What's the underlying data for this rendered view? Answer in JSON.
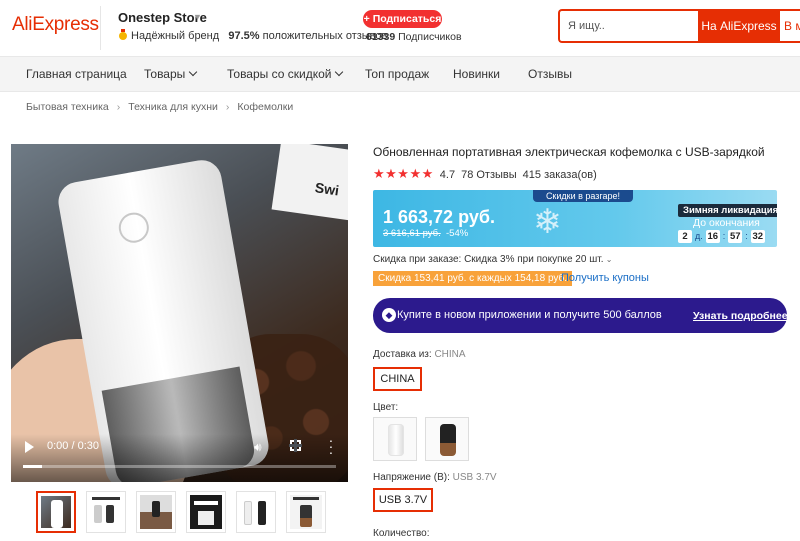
{
  "header": {
    "logo": "AliExpress",
    "store_name": "Onestep Store",
    "trusted_brand": "Надёжный бренд",
    "positive_percent": "97.5%",
    "positive_label": "положительных отзывов",
    "subscribe_label": "+ Подписаться",
    "subscriber_count": "61339",
    "subscriber_label": "Подписчиков",
    "search_placeholder": "Я ищу..",
    "search_button": "На AliExpress",
    "search_button2": "В магазине"
  },
  "nav": {
    "items": [
      "Главная страница",
      "Товары",
      "Товары со скидкой",
      "Топ продаж",
      "Новинки",
      "Отзывы"
    ]
  },
  "breadcrumb": [
    "Бытовая техника",
    "Техника для кухни",
    "Кофемолки"
  ],
  "video": {
    "time": "0:00 / 0:30",
    "progress": 0.06,
    "box_text": "Swi"
  },
  "product": {
    "title": "Обновленная портативная электрическая кофемолка с USB-зарядкой",
    "rating": "4.7",
    "rating_value": 4.7,
    "reviews": "78 Отзывы",
    "orders": "415 заказа(ов)",
    "promo_tag": "Скидки в разгаре!",
    "price": "1 663,72 руб.",
    "old_price": "3 616,61 руб.",
    "discount_pct": "-54%",
    "sale_title": "Зимняя ликвидация",
    "until_label": "До окончания",
    "timer": {
      "days": "2",
      "days_label": "д.",
      "hours": "16",
      "minutes": "57",
      "seconds": "32"
    },
    "discount_line": "Скидка при заказе: Скидка 3% при покупке 20 шт.",
    "coupon_text": "Скидка 153,41 руб. с каждых 154,18 руб.",
    "get_coupons": "Получить купоны",
    "app_banner": "Купите в новом приложении и получите 500 баллов",
    "app_more": "Узнать подробнее",
    "ship_label": "Доставка из:",
    "ship_value": "CHINA",
    "ship_option": "CHINA",
    "color_label": "Цвет:",
    "voltage_label": "Напряжение (В):",
    "voltage_value": "USB 3.7V",
    "voltage_option": "USB 3.7V",
    "qty_label": "Количество:"
  },
  "colors": {
    "brand": "#e62e04",
    "star": "#f23030",
    "promo": "#3db7e4",
    "banner": "#2c1a8d",
    "coupon": "#f8a23a",
    "link": "#1a6ec6"
  }
}
